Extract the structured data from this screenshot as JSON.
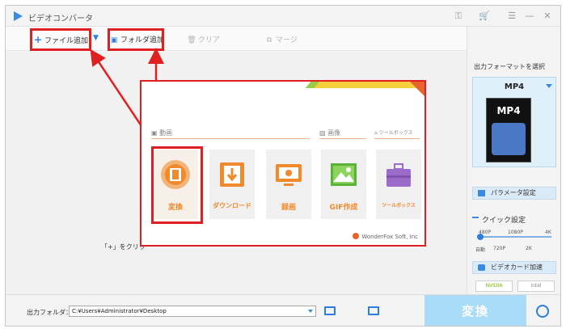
{
  "app": {
    "title": "ビデオコンバータ"
  },
  "toolbar": {
    "add_file": "ファイル追加",
    "add_folder": "フォルダ追加",
    "clear": "クリア",
    "merge": "マージ"
  },
  "main": {
    "hint": "「+」をクリッ"
  },
  "panel": {
    "sections": {
      "video": "動画",
      "image": "画像",
      "toolbox": "ツールボックス"
    },
    "tiles": [
      {
        "label": "変換",
        "icon": "film-reel-icon"
      },
      {
        "label": "ダウンロード",
        "icon": "download-icon"
      },
      {
        "label": "録画",
        "icon": "screen-record-icon"
      },
      {
        "label": "GIF作成",
        "icon": "image-icon"
      },
      {
        "label": "ツールボックス",
        "icon": "toolbox-icon"
      }
    ],
    "brand": "WonderFox Soft, Inc"
  },
  "sidebar": {
    "output_format_title": "出力フォーマットを選択",
    "format": "MP4",
    "thumb_text": "MP4",
    "param_button": "パラメータ設定",
    "quick_settings": "クイック設定",
    "scale_top": [
      "480P",
      "1080P",
      "4K"
    ],
    "scale_bottom": [
      "自動",
      "720P",
      "2K"
    ],
    "gpu_button": "ビデオカード加速",
    "gpu_vendors": [
      "NVIDIA",
      "intel"
    ]
  },
  "bottom": {
    "output_folder_label": "出力フォルダ：",
    "output_path": "C:¥Users¥Administrator¥Desktop",
    "convert_button": "変換"
  },
  "colors": {
    "accent": "#2b7de0",
    "highlight_red": "#e02020",
    "orange": "#f08a2c",
    "convert_bg": "#a9dcf7"
  }
}
